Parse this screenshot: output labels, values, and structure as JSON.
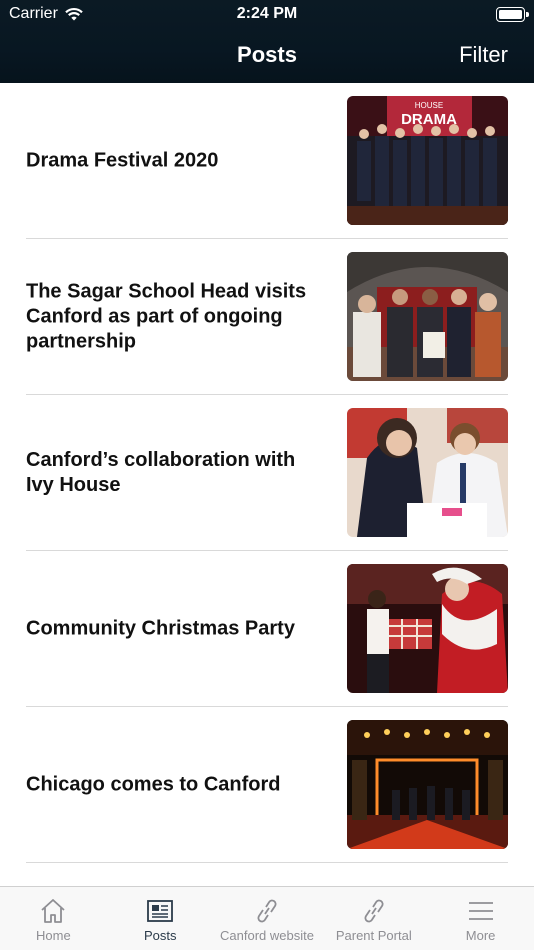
{
  "status_bar": {
    "carrier": "Carrier",
    "time": "2:24 PM"
  },
  "nav": {
    "title": "Posts",
    "filter_label": "Filter"
  },
  "posts": [
    {
      "title": "Drama Festival 2020",
      "image": "drama-festival-photo"
    },
    {
      "title": "The Sagar School Head visits Canford as part of ongoing partnership",
      "image": "sagar-school-visit-photo"
    },
    {
      "title": "Canford’s collaboration with Ivy House",
      "image": "ivy-house-collaboration-photo"
    },
    {
      "title": "Community Christmas Party",
      "image": "christmas-party-photo"
    },
    {
      "title": "Chicago comes to Canford",
      "image": "chicago-stage-photo"
    }
  ],
  "tabs": [
    {
      "label": "Home",
      "icon": "home-icon",
      "active": false
    },
    {
      "label": "Posts",
      "icon": "newspaper-icon",
      "active": true
    },
    {
      "label": "Canford website",
      "icon": "link-icon",
      "active": false
    },
    {
      "label": "Parent Portal",
      "icon": "link-icon",
      "active": false
    },
    {
      "label": "More",
      "icon": "hamburger-icon",
      "active": false
    }
  ],
  "colors": {
    "nav_bg": "#081722",
    "active_tab": "#2b3b4a",
    "inactive_tab": "#8e8e93"
  }
}
